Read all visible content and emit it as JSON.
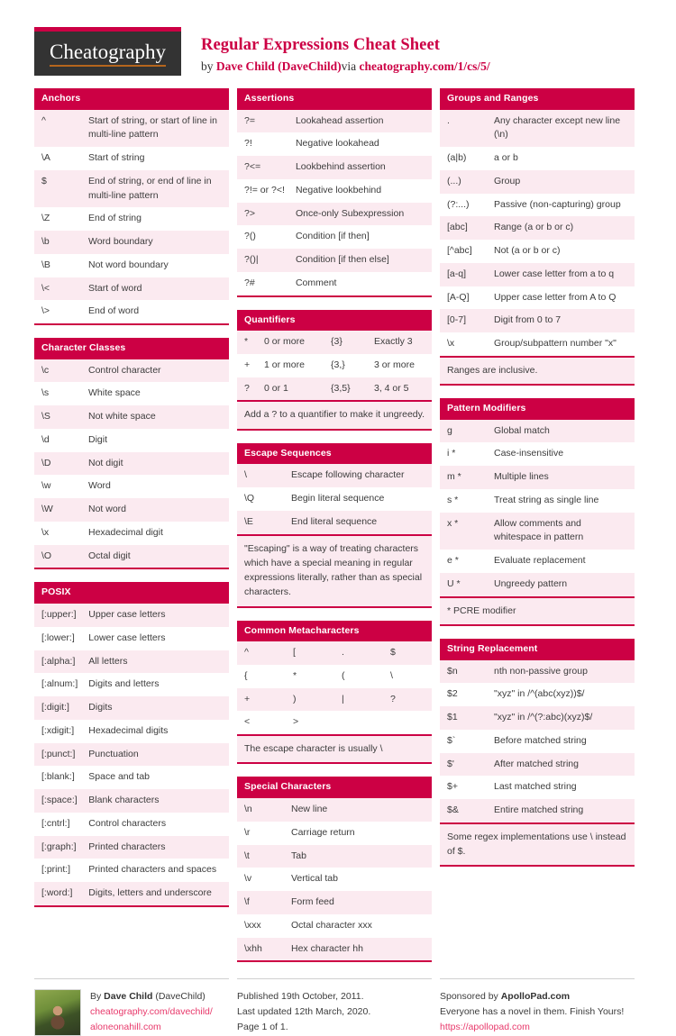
{
  "header": {
    "logo_text": "Cheatography",
    "title": "Regular Expressions Cheat Sheet",
    "by_prefix": "by ",
    "author": "Dave Child (DaveChild)",
    "via": "via ",
    "url": "cheatography.com/1/cs/5/"
  },
  "columns": [
    {
      "sections": [
        {
          "title": "Anchors",
          "type": "kv",
          "rows": [
            [
              "^",
              "Start of string, or start of line in multi-line pattern"
            ],
            [
              "\\A",
              "Start of string"
            ],
            [
              "$",
              "End of string, or end of line in multi-line pattern"
            ],
            [
              "\\Z",
              "End of string"
            ],
            [
              "\\b",
              "Word boundary"
            ],
            [
              "\\B",
              "Not word boundary"
            ],
            [
              "\\<",
              "Start of word"
            ],
            [
              "\\>",
              "End of word"
            ]
          ]
        },
        {
          "title": "Character Classes",
          "type": "kv",
          "rows": [
            [
              "\\c",
              "Control character"
            ],
            [
              "\\s",
              "White space"
            ],
            [
              "\\S",
              "Not white space"
            ],
            [
              "\\d",
              "Digit"
            ],
            [
              "\\D",
              "Not digit"
            ],
            [
              "\\w",
              "Word"
            ],
            [
              "\\W",
              "Not word"
            ],
            [
              "\\x",
              "Hexadecimal digit"
            ],
            [
              "\\O",
              "Octal digit"
            ]
          ]
        },
        {
          "title": "POSIX",
          "type": "kv",
          "rows": [
            [
              "[:upper:]",
              "Upper case letters"
            ],
            [
              "[:lower:]",
              "Lower case letters"
            ],
            [
              "[:alpha:]",
              "All letters"
            ],
            [
              "[:alnum:]",
              "Digits and letters"
            ],
            [
              "[:digit:]",
              "Digits"
            ],
            [
              "[:xdigit:]",
              "Hexadecimal digits"
            ],
            [
              "[:punct:]",
              "Punctuation"
            ],
            [
              "[:blank:]",
              "Space and tab"
            ],
            [
              "[:space:]",
              "Blank characters"
            ],
            [
              "[:cntrl:]",
              "Control characters"
            ],
            [
              "[:graph:]",
              "Printed characters"
            ],
            [
              "[:print:]",
              "Printed characters and spaces"
            ],
            [
              "[:word:]",
              "Digits, letters and underscore"
            ]
          ]
        }
      ]
    },
    {
      "sections": [
        {
          "title": "Assertions",
          "type": "kv",
          "rows": [
            [
              "?=",
              "Lookahead assertion"
            ],
            [
              "?!",
              "Negative lookahead"
            ],
            [
              "?<=",
              "Lookbehind assertion"
            ],
            [
              "?!= or ?<!",
              "Negative lookbehind"
            ],
            [
              "?>",
              "Once-only Subexpression"
            ],
            [
              "?()",
              "Condition [if then]"
            ],
            [
              "?()|",
              "Condition [if then else]"
            ],
            [
              "?#",
              "Comment"
            ]
          ]
        },
        {
          "title": "Quantifiers",
          "type": "quad",
          "rows": [
            [
              "*",
              "0 or more",
              "{3}",
              "Exactly 3"
            ],
            [
              "+",
              "1 or more",
              "{3,}",
              "3 or more"
            ],
            [
              "?",
              "0 or 1",
              "{3,5}",
              "3, 4 or 5"
            ]
          ],
          "note": "Add a ? to a quantifier to make it ungreedy."
        },
        {
          "title": "Escape Sequences",
          "type": "kv",
          "rows": [
            [
              "\\",
              "Escape following character"
            ],
            [
              "\\Q",
              "Begin literal sequence"
            ],
            [
              "\\E",
              "End literal sequence"
            ]
          ],
          "note": "\"Escaping\" is a way of treating characters which have a special meaning in regular expressions literally, rather than as special characters."
        },
        {
          "title": "Common Metacharacters",
          "type": "meta",
          "rows": [
            [
              "^",
              "[",
              ".",
              "$"
            ],
            [
              "{",
              "*",
              "(",
              "\\"
            ],
            [
              "+",
              ")",
              "|",
              "?"
            ],
            [
              "<",
              ">",
              "",
              ""
            ]
          ],
          "note": "The escape character is usually \\"
        },
        {
          "title": "Special Characters",
          "type": "kv",
          "rows": [
            [
              "\\n",
              "New line"
            ],
            [
              "\\r",
              "Carriage return"
            ],
            [
              "\\t",
              "Tab"
            ],
            [
              "\\v",
              "Vertical tab"
            ],
            [
              "\\f",
              "Form feed"
            ],
            [
              "\\xxx",
              "Octal character xxx"
            ],
            [
              "\\xhh",
              "Hex character hh"
            ]
          ]
        }
      ]
    },
    {
      "sections": [
        {
          "title": "Groups and Ranges",
          "type": "kv",
          "rows": [
            [
              ".",
              "Any character except new line (\\n)"
            ],
            [
              "(a|b)",
              "a or b"
            ],
            [
              "(...)",
              "Group"
            ],
            [
              "(?:...)",
              "Passive (non-capturing) group"
            ],
            [
              "[abc]",
              "Range (a or b or c)"
            ],
            [
              "[^abc]",
              "Not (a or b or c)"
            ],
            [
              "[a-q]",
              "Lower case letter from a to q"
            ],
            [
              "[A-Q]",
              "Upper case letter from A to Q"
            ],
            [
              "[0-7]",
              "Digit from 0 to 7"
            ],
            [
              "\\x",
              "Group/subpattern number \"x\""
            ]
          ],
          "note": "Ranges are inclusive."
        },
        {
          "title": "Pattern Modifiers",
          "type": "kv",
          "rows": [
            [
              "g",
              "Global match"
            ],
            [
              "i *",
              "Case-insensitive"
            ],
            [
              "m *",
              "Multiple lines"
            ],
            [
              "s *",
              "Treat string as single line"
            ],
            [
              "x *",
              "Allow comments and whitespace in pattern"
            ],
            [
              "e *",
              "Evaluate replacement"
            ],
            [
              "U *",
              "Ungreedy pattern"
            ]
          ],
          "note": "* PCRE modifier"
        },
        {
          "title": "String Replacement",
          "type": "kv",
          "rows": [
            [
              "$n",
              "nth non-passive group"
            ],
            [
              "$2",
              "\"xyz\" in /^(abc(xyz))$/"
            ],
            [
              "$1",
              "\"xyz\" in /^(?:abc)(xyz)$/"
            ],
            [
              "$`",
              "Before matched string"
            ],
            [
              "$'",
              "After matched string"
            ],
            [
              "$+",
              "Last matched string"
            ],
            [
              "$&",
              "Entire matched string"
            ]
          ],
          "note": "Some regex implementations use \\ instead of $."
        }
      ]
    }
  ],
  "footer": {
    "author": {
      "by_prefix": "By ",
      "name": "Dave Child",
      "handle": " (DaveChild)",
      "link1": "cheatography.com/davechild/",
      "link2": "aloneonahill.com"
    },
    "publish": {
      "published": "Published 19th October, 2011.",
      "updated": "Last updated 12th March, 2020.",
      "page": "Page 1 of 1."
    },
    "sponsor": {
      "prefix": "Sponsored by ",
      "name": "ApolloPad.com",
      "tagline": "Everyone has a novel in them. Finish Yours!",
      "link": "https://apollopad.com"
    }
  },
  "colors": {
    "accent": "#cc0044",
    "row_alt": "#fbeaf0",
    "link": "#e8396b",
    "logo_bg": "#333333"
  }
}
